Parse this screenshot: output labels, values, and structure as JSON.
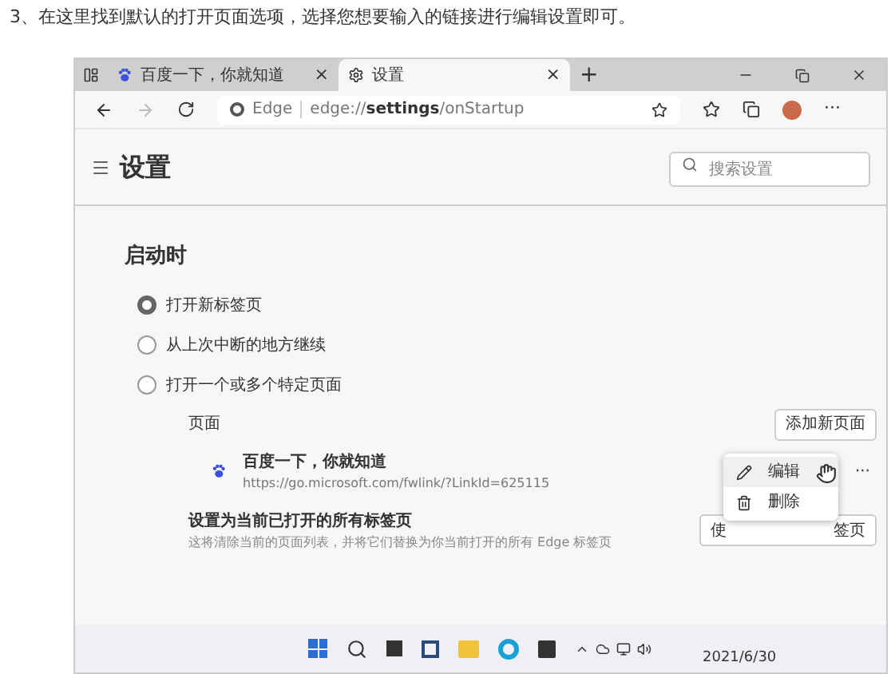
{
  "article": {
    "caption": "3、在这里找到默认的打开页面选项，选择您想要输入的链接进行编辑设置即可。"
  },
  "browser": {
    "tabs": [
      {
        "title": "百度一下，你就知道",
        "close": "×",
        "selected": false,
        "kind": "site"
      },
      {
        "title": "设置",
        "close": "×",
        "selected": true,
        "kind": "settings"
      }
    ],
    "new_tab": "+",
    "address": {
      "brand": "Edge",
      "url_prefix": "edge://",
      "url_bold": "settings",
      "url_suffix": "/onStartup"
    },
    "more": "···"
  },
  "settings": {
    "title": "设置",
    "search": {
      "placeholder": "搜索设置"
    },
    "section": "启动时",
    "options": [
      {
        "label": "打开新标签页",
        "selected": true
      },
      {
        "label": "从上次中断的地方继续",
        "selected": false
      },
      {
        "label": "打开一个或多个特定页面",
        "selected": false
      }
    ],
    "pages_label": "页面",
    "add_button": "添加新页面",
    "page": {
      "title": "百度一下，你就知道",
      "url": "https://go.microsoft.com/fwlink/?LinkId=625115",
      "more": "···"
    },
    "menu": [
      {
        "label": "编辑",
        "kind": "edit",
        "hovered": true
      },
      {
        "label": "删除",
        "kind": "delete",
        "hovered": false
      }
    ],
    "use_open": {
      "title": "设置为当前已打开的所有标签页",
      "desc": "这将清除当前的页面列表，并将它们替换为你当前打开的所有 Edge 标签页",
      "button_start": "使",
      "button_end": "签页"
    }
  },
  "taskbar": {
    "date": "2021/6/30"
  }
}
